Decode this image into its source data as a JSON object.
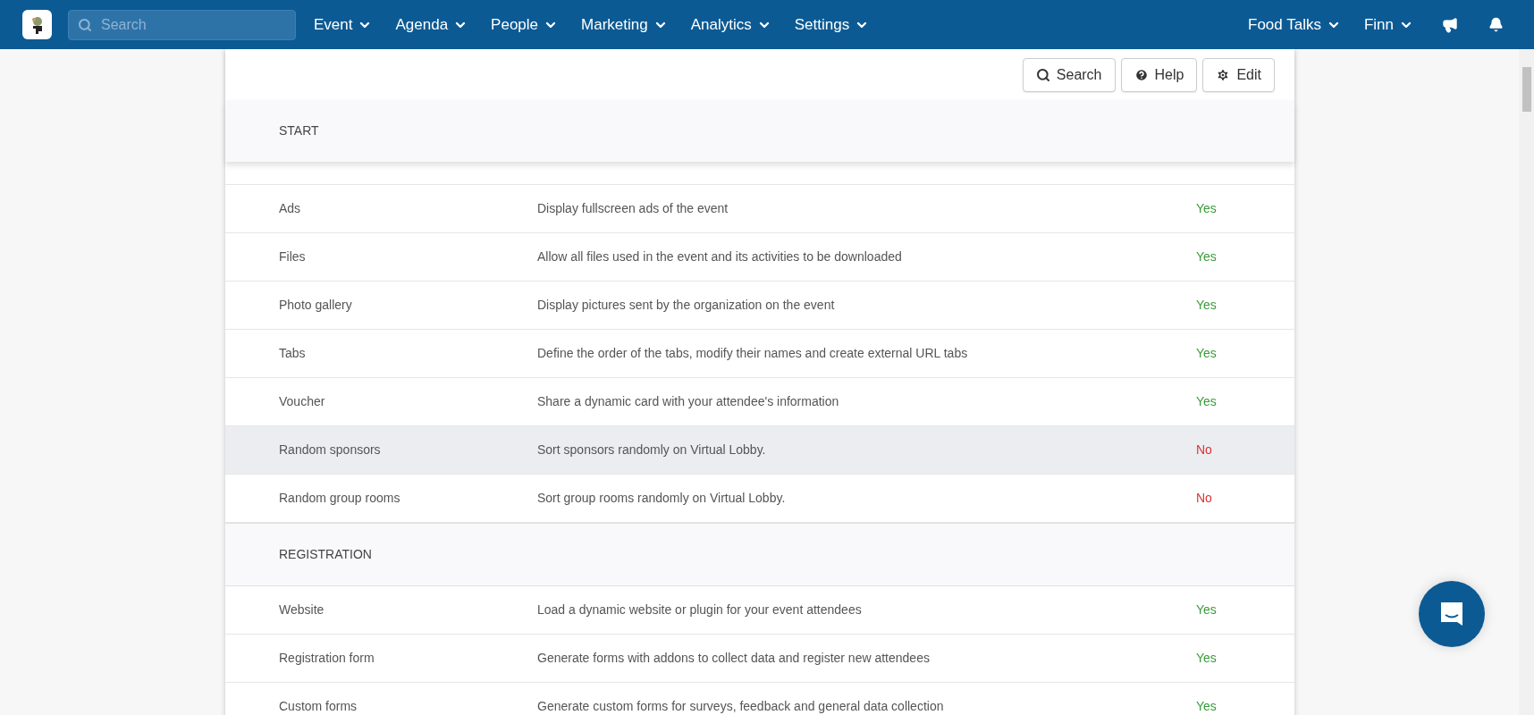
{
  "nav": {
    "search": {
      "placeholder": "Search"
    },
    "menus": [
      "Event",
      "Agenda",
      "People",
      "Marketing",
      "Analytics",
      "Settings"
    ],
    "right_menus": [
      "Food Talks",
      "Finn"
    ]
  },
  "toolbar": {
    "buttons": [
      {
        "label": "Search",
        "kind": "search"
      },
      {
        "label": "Help",
        "kind": "help"
      },
      {
        "label": "Edit",
        "kind": "edit"
      }
    ]
  },
  "sections": [
    {
      "title": "START",
      "rows": [
        {
          "name": "Ads",
          "description": "Display fullscreen ads of the event",
          "value": "Yes",
          "enabled": true,
          "hovered": false
        },
        {
          "name": "Files",
          "description": "Allow all files used in the event and its activities to be downloaded",
          "value": "Yes",
          "enabled": true,
          "hovered": false
        },
        {
          "name": "Photo gallery",
          "description": "Display pictures sent by the organization on the event",
          "value": "Yes",
          "enabled": true,
          "hovered": false
        },
        {
          "name": "Tabs",
          "description": "Define the order of the tabs, modify their names and create external URL tabs",
          "value": "Yes",
          "enabled": true,
          "hovered": false
        },
        {
          "name": "Voucher",
          "description": "Share a dynamic card with your attendee's information",
          "value": "Yes",
          "enabled": true,
          "hovered": false
        },
        {
          "name": "Random sponsors",
          "description": "Sort sponsors randomly on Virtual Lobby.",
          "value": "No",
          "enabled": false,
          "hovered": true
        },
        {
          "name": "Random group rooms",
          "description": "Sort group rooms randomly on Virtual Lobby.",
          "value": "No",
          "enabled": false,
          "hovered": false
        }
      ]
    },
    {
      "title": "REGISTRATION",
      "rows": [
        {
          "name": "Website",
          "description": "Load a dynamic website or plugin for your event attendees",
          "value": "Yes",
          "enabled": true,
          "hovered": false
        },
        {
          "name": "Registration form",
          "description": "Generate forms with addons to collect data and register new attendees",
          "value": "Yes",
          "enabled": true,
          "hovered": false
        },
        {
          "name": "Custom forms",
          "description": "Generate custom forms for surveys, feedback and general data collection",
          "value": "Yes",
          "enabled": true,
          "hovered": false
        }
      ]
    }
  ]
}
